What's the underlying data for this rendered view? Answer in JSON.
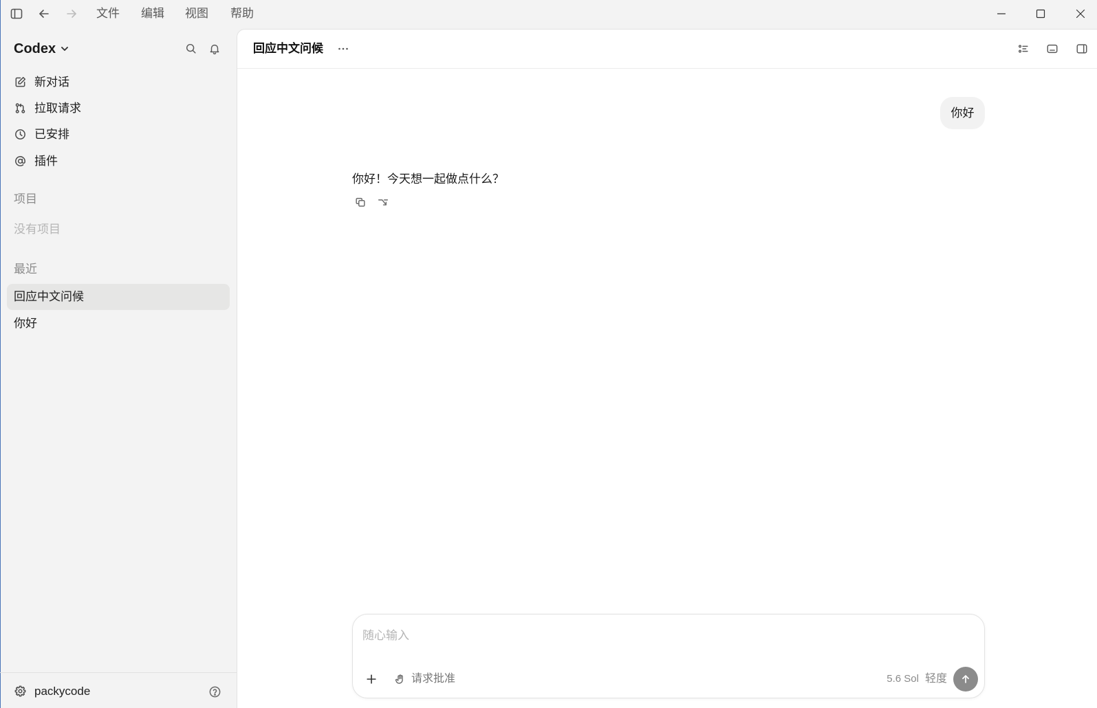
{
  "titlebar": {
    "menu": [
      "文件",
      "编辑",
      "视图",
      "帮助"
    ]
  },
  "sidebar": {
    "app_name": "Codex",
    "nav": [
      {
        "label": "新对话",
        "icon": "new-chat-icon"
      },
      {
        "label": "拉取请求",
        "icon": "pull-request-icon"
      },
      {
        "label": "已安排",
        "icon": "clock-icon"
      },
      {
        "label": "插件",
        "icon": "at-sign-icon"
      }
    ],
    "projects": {
      "heading": "项目",
      "empty_text": "没有项目"
    },
    "recent": {
      "heading": "最近",
      "items": [
        {
          "label": "回应中文问候",
          "selected": true
        },
        {
          "label": "你好",
          "selected": false
        }
      ]
    },
    "account": {
      "name": "packycode"
    }
  },
  "thread": {
    "title": "回应中文问候",
    "user_message": "你好",
    "assistant_message": "你好！今天想一起做点什么？"
  },
  "composer": {
    "placeholder": "随心输入",
    "approval_label": "请求批准",
    "model": "5.6 Sol",
    "effort": "轻度"
  },
  "colors": {
    "sidebar_bg": "#f3f3f3",
    "main_bg": "#ffffff",
    "selected_row_bg": "#e6e6e5",
    "user_bubble_bg": "#f2f2f2",
    "send_button_bg": "#8b8b8b",
    "muted_text": "#8b8b8b",
    "window_border_accent": "#4a74b8"
  }
}
